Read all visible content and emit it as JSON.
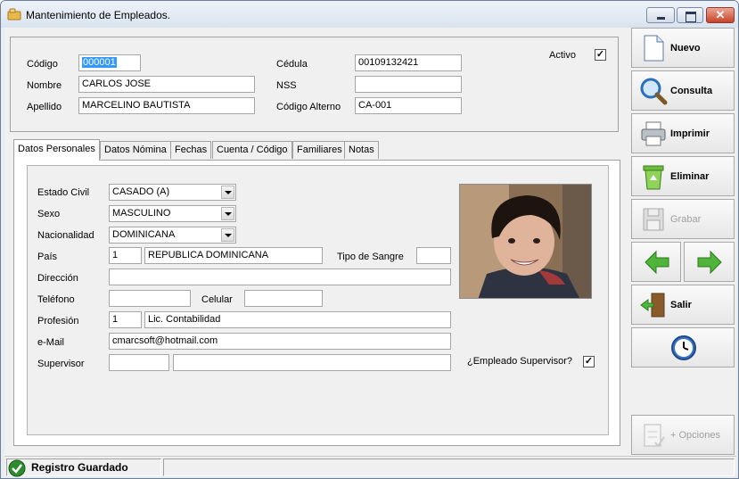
{
  "window": {
    "title": "Mantenimiento de Empleados."
  },
  "header": {
    "codigo_label": "Código",
    "codigo_value": "000001",
    "nombre_label": "Nombre",
    "nombre_value": "CARLOS JOSE",
    "apellido_label": "Apellido",
    "apellido_value": "MARCELINO BAUTISTA",
    "cedula_label": "Cédula",
    "cedula_value": "00109132421",
    "nss_label": "NSS",
    "nss_value": "",
    "codigo_alterno_label": "Código Alterno",
    "codigo_alterno_value": "CA-001",
    "activo_label": "Activo",
    "activo_checked": "✓"
  },
  "tabs": [
    {
      "label": "Datos Personales"
    },
    {
      "label": "Datos Nómina"
    },
    {
      "label": "Fechas"
    },
    {
      "label": "Cuenta / Código"
    },
    {
      "label": "Familiares"
    },
    {
      "label": "Notas"
    }
  ],
  "personal": {
    "estado_civil_label": "Estado Civil",
    "estado_civil_value": "CASADO (A)",
    "sexo_label": "Sexo",
    "sexo_value": "MASCULINO",
    "nacionalidad_label": "Nacionalidad",
    "nacionalidad_value": "DOMINICANA",
    "pais_label": "País",
    "pais_code": "1",
    "pais_name": "REPUBLICA DOMINICANA",
    "tipo_sangre_label": "Tipo de Sangre",
    "tipo_sangre_value": "",
    "direccion_label": "Dirección",
    "direccion_value": "",
    "telefono_label": "Teléfono",
    "telefono_value": "",
    "celular_label": "Celular",
    "celular_value": "",
    "profesion_label": "Profesión",
    "profesion_code": "1",
    "profesion_name": "Lic. Contabilidad",
    "email_label": "e-Mail",
    "email_value": "cmarcsoft@hotmail.com",
    "supervisor_label": "Supervisor",
    "supervisor_code": "",
    "supervisor_name": "",
    "empleado_supervisor_label": "¿Empleado Supervisor?",
    "empleado_supervisor_checked": "✓"
  },
  "sidebar": {
    "nuevo": "Nuevo",
    "consulta": "Consulta",
    "imprimir": "Imprimir",
    "eliminar": "Eliminar",
    "grabar": "Grabar",
    "salir": "Salir",
    "opciones": "+ Opciones"
  },
  "status": {
    "message": "Registro Guardado"
  },
  "colors": {
    "accent": "#3399ff",
    "status_ok": "#2e8b2e"
  }
}
